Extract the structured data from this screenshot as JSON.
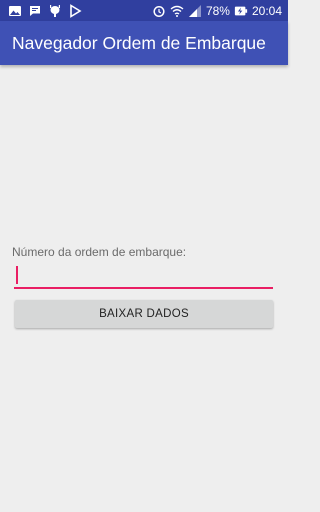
{
  "status_bar": {
    "icons_left": [
      "image-icon",
      "chat-icon",
      "usb-debug-icon",
      "play-store-icon"
    ],
    "icons_right": [
      "alarm-icon",
      "wifi-icon",
      "signal-icon",
      "battery-charging-icon"
    ],
    "battery": "78%",
    "time": "20:04"
  },
  "app_bar": {
    "title": "Navegador Ordem de Embarque"
  },
  "form": {
    "label": "Número da ordem de embarque:",
    "input_value": "",
    "button_label": "BAIXAR DADOS"
  },
  "colors": {
    "status_bar": "#303f9f",
    "primary": "#3f51b5",
    "accent": "#e91e63",
    "background": "#eeeeee",
    "button": "#d6d7d7"
  }
}
